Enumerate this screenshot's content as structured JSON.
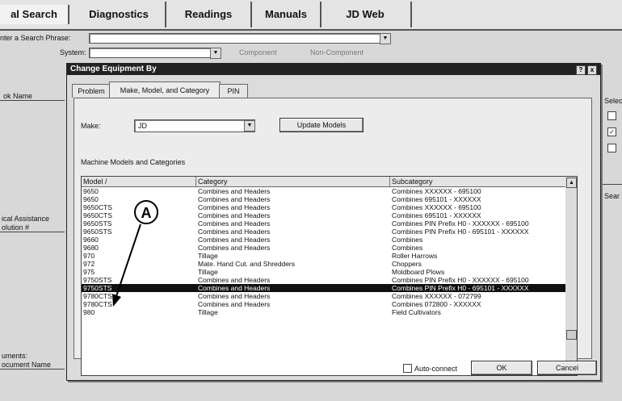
{
  "top_tabs": [
    {
      "label": "al Search"
    },
    {
      "label": "Diagnostics"
    },
    {
      "label": "Readings"
    },
    {
      "label": "Manuals"
    },
    {
      "label": "JD Web"
    }
  ],
  "background": {
    "search_phrase_label": "nter a Search Phrase:",
    "system_label": "System:",
    "component_button": "Component",
    "non_component_button": "Non-Component",
    "book_name_header": "ok Name",
    "tech_assistance_label": "ical Assistance",
    "solution_label": "olution #",
    "documents_label": "uments:",
    "document_name_label": "ocument Name",
    "select_label": "Selec",
    "search_label": "Sear"
  },
  "dialog": {
    "title": "Change Equipment By",
    "help_button": "?",
    "close_button": "x",
    "tabs": [
      {
        "label": "Problem",
        "active": false
      },
      {
        "label": "Make, Model, and Category",
        "active": true
      },
      {
        "label": "PIN",
        "active": false
      }
    ],
    "make_label": "Make:",
    "make_value": "JD",
    "update_models_button": "Update Models",
    "section_label": "Machine Models and Categories",
    "table": {
      "columns": [
        "Model /",
        "Category",
        "Subcategory"
      ],
      "rows": [
        {
          "model": "9650",
          "category": "Combines and Headers",
          "subcategory": "Combines XXXXXX - 695100"
        },
        {
          "model": "9650",
          "category": "Combines and Headers",
          "subcategory": "Combines 695101 - XXXXXX"
        },
        {
          "model": "9650CTS",
          "category": "Combines and Headers",
          "subcategory": "Combines XXXXXX - 695100"
        },
        {
          "model": "9650CTS",
          "category": "Combines and Headers",
          "subcategory": "Combines 695101 - XXXXXX"
        },
        {
          "model": "9650STS",
          "category": "Combines and Headers",
          "subcategory": "Combines PIN Prefix H0 - XXXXXX - 695100"
        },
        {
          "model": "9650STS",
          "category": "Combines and Headers",
          "subcategory": "Combines PIN Prefix H0 - 695101 - XXXXXX"
        },
        {
          "model": "9660",
          "category": "Combines and Headers",
          "subcategory": "Combines"
        },
        {
          "model": "9680",
          "category": "Combines and Headers",
          "subcategory": "Combines"
        },
        {
          "model": "970",
          "category": "Tillage",
          "subcategory": "Roller Harrows"
        },
        {
          "model": "972",
          "category": "Mate. Hand Cut. and Shredders",
          "subcategory": "Choppers"
        },
        {
          "model": "975",
          "category": "Tillage",
          "subcategory": "Moldboard Plows"
        },
        {
          "model": "9750STS",
          "category": "Combines and Headers",
          "subcategory": "Combines PIN Prefix H0 - XXXXXX - 695100"
        },
        {
          "model": "9750STS",
          "category": "Combines and Headers",
          "subcategory": "Combines PIN Prefix H0 - 695101 - XXXXXX",
          "selected": true
        },
        {
          "model": "9780CTS",
          "category": "Combines and Headers",
          "subcategory": "Combines XXXXXX - 072799"
        },
        {
          "model": "9780CTS",
          "category": "Combines and Headers",
          "subcategory": "Combines 072800 - XXXXXX"
        },
        {
          "model": "980",
          "category": "Tillage",
          "subcategory": "Field Cultivators"
        }
      ]
    },
    "auto_connect_label": "Auto-connect",
    "ok_button": "OK",
    "cancel_button": "Cancel"
  },
  "callout": {
    "label": "A"
  }
}
